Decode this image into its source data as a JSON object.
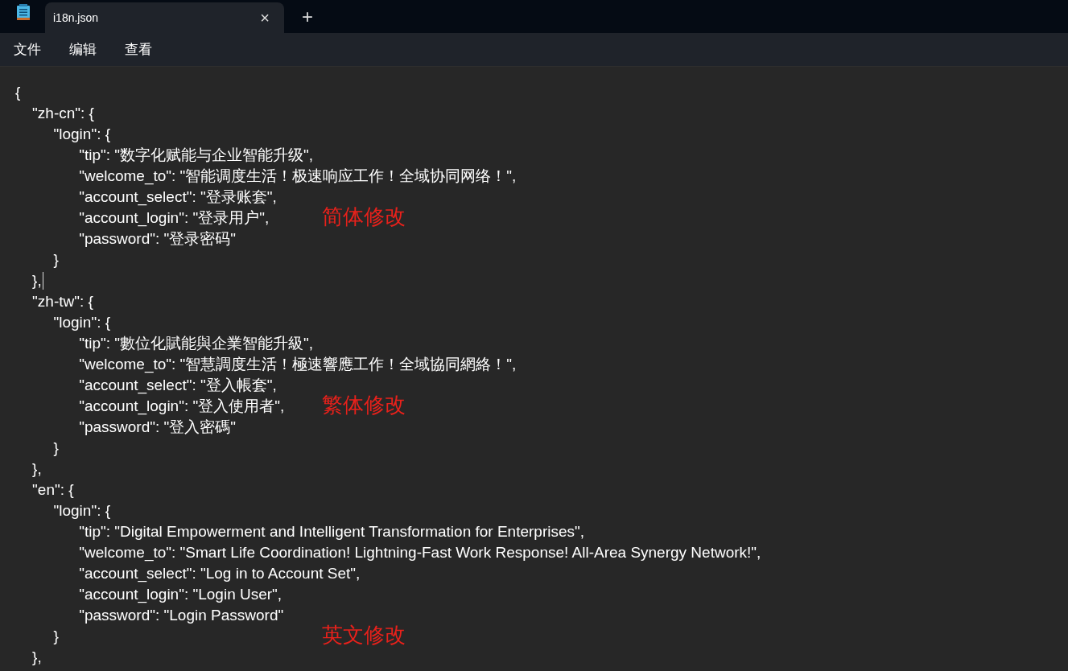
{
  "window": {
    "tabs": [
      {
        "title": "i18n.json",
        "selected": true,
        "close": "×"
      }
    ],
    "new_tab": "+"
  },
  "menu": [
    "文件",
    "编辑",
    "查看"
  ],
  "editor": {
    "lines": [
      {
        "text": "{",
        "cursor": false
      },
      {
        "text": "    \"zh-cn\": {",
        "cursor": false
      },
      {
        "text": "         \"login\": {",
        "cursor": false
      },
      {
        "text": "               \"tip\": \"数字化赋能与企业智能升级\",",
        "cursor": false
      },
      {
        "text": "               \"welcome_to\": \"智能调度生活！极速响应工作！全域协同网络！\",",
        "cursor": false
      },
      {
        "text": "               \"account_select\": \"登录账套\",",
        "cursor": false
      },
      {
        "text": "               \"account_login\": \"登录用户\",",
        "cursor": false,
        "annotation": "简体修改"
      },
      {
        "text": "               \"password\": \"登录密码\"",
        "cursor": false
      },
      {
        "text": "         }",
        "cursor": false
      },
      {
        "text": "    },",
        "cursor": true
      },
      {
        "text": "    \"zh-tw\": {",
        "cursor": false
      },
      {
        "text": "         \"login\": {",
        "cursor": false
      },
      {
        "text": "               \"tip\": \"數位化賦能與企業智能升級\",",
        "cursor": false
      },
      {
        "text": "               \"welcome_to\": \"智慧調度生活！極速響應工作！全域協同網絡！\",",
        "cursor": false
      },
      {
        "text": "               \"account_select\": \"登入帳套\",",
        "cursor": false
      },
      {
        "text": "               \"account_login\": \"登入使用者\",",
        "cursor": false,
        "annotation": "繁体修改"
      },
      {
        "text": "               \"password\": \"登入密碼\"",
        "cursor": false
      },
      {
        "text": "         }",
        "cursor": false
      },
      {
        "text": "    },",
        "cursor": false
      },
      {
        "text": "    \"en\": {",
        "cursor": false
      },
      {
        "text": "         \"login\": {",
        "cursor": false
      },
      {
        "text": "               \"tip\": \"Digital Empowerment and Intelligent Transformation for Enterprises\",",
        "cursor": false
      },
      {
        "text": "               \"welcome_to\": \"Smart Life Coordination! Lightning-Fast Work Response! All-Area Synergy Network!\",",
        "cursor": false
      },
      {
        "text": "               \"account_select\": \"Log in to Account Set\",",
        "cursor": false
      },
      {
        "text": "               \"account_login\": \"Login User\",",
        "cursor": false
      },
      {
        "text": "               \"password\": \"Login Password\"",
        "cursor": false
      },
      {
        "text": "         }",
        "cursor": false,
        "annotation": "英文修改"
      },
      {
        "text": "    },",
        "cursor": false
      }
    ]
  }
}
